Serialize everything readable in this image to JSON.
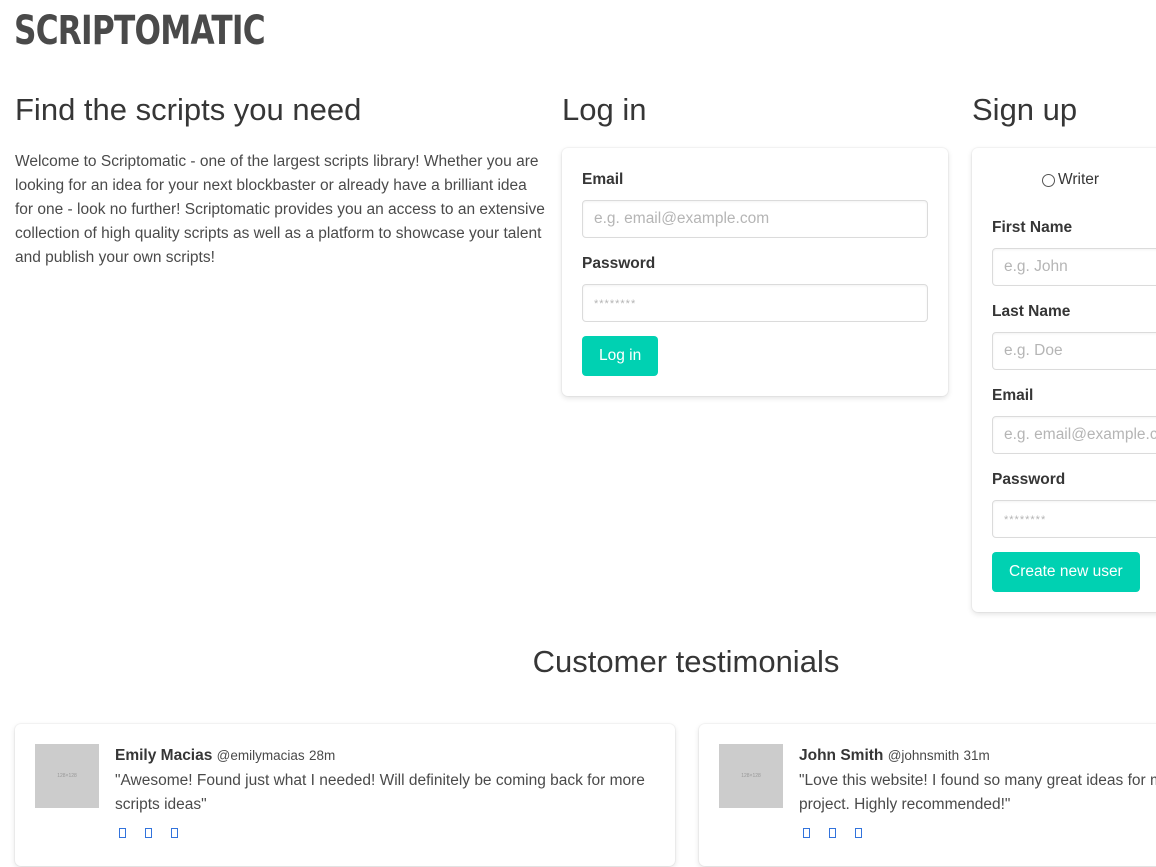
{
  "brand": {
    "logo": "SCRIPTOMATIC"
  },
  "intro": {
    "title": "Find the scripts you need",
    "text": "Welcome to Scriptomatic - one of the largest scripts library! Whether you are looking for an idea for your next blockbaster or already have a brilliant idea for one - look no further! Scriptomatic provides you an access to an extensive collection of high quality scripts as well as a platform to showcase your talent and publish your own scripts!"
  },
  "login": {
    "title": "Log in",
    "email_label": "Email",
    "email_placeholder": "e.g. email@example.com",
    "password_label": "Password",
    "password_placeholder": "********",
    "button": "Log in"
  },
  "signup": {
    "title": "Sign up",
    "role_option": "Writer",
    "first_name_label": "First Name",
    "first_name_placeholder": "e.g. John",
    "last_name_label": "Last Name",
    "last_name_placeholder": "e.g. Doe",
    "email_label": "Email",
    "email_placeholder": "e.g. email@example.com",
    "password_label": "Password",
    "password_placeholder": "********",
    "button": "Create new user"
  },
  "testimonials": {
    "title": "Customer testimonials",
    "items": [
      {
        "avatar_text": "128×128",
        "name": "Emily Macias",
        "handle": "@emilymacias",
        "time": "28m",
        "text": "\"Awesome! Found just what I needed! Will definitely be coming back for more scripts ideas\""
      },
      {
        "avatar_text": "128×128",
        "name": "John Smith",
        "handle": "@johnsmith",
        "time": "31m",
        "text": "\"Love this website! I found so many great ideas for my Arts class final project. Highly recommended!\""
      }
    ],
    "action_icons": [
      "reply-icon",
      "retweet-icon",
      "heart-icon"
    ]
  },
  "colors": {
    "primary": "#00d1b2",
    "text": "#4a4a4a",
    "icon": "#3273dc"
  }
}
